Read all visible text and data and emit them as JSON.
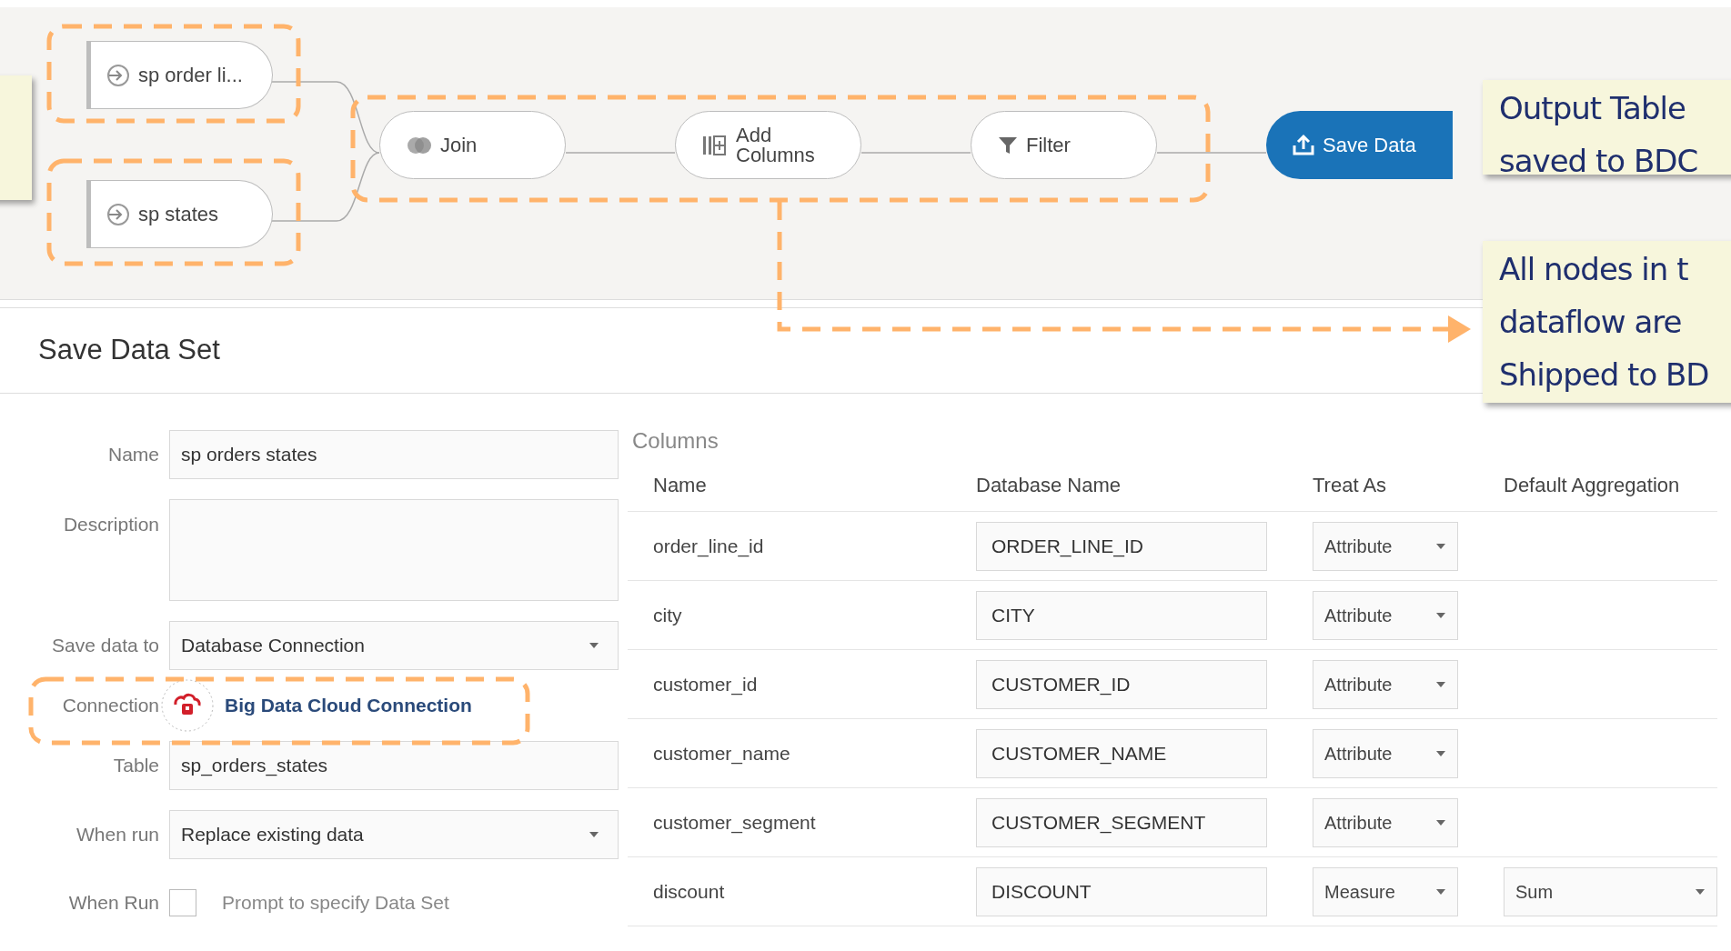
{
  "flow": {
    "nodes": [
      {
        "label": "sp order li...",
        "kind": "source"
      },
      {
        "label": "sp states",
        "kind": "source"
      },
      {
        "label": "Join",
        "kind": "join"
      },
      {
        "label": "Add Columns",
        "kind": "add_columns"
      },
      {
        "label": "Filter",
        "kind": "filter"
      },
      {
        "label": "Save Data",
        "kind": "save"
      }
    ]
  },
  "callouts": [
    {
      "lines": [
        "Output Table",
        "saved to BDC"
      ]
    },
    {
      "lines": [
        "All nodes in t",
        "dataflow are",
        "Shipped to BD"
      ]
    }
  ],
  "panel": {
    "title": "Save Data Set",
    "fields": [
      {
        "kind": "text",
        "label": "Name",
        "value": "sp orders states"
      },
      {
        "kind": "textarea",
        "label": "Description"
      },
      {
        "kind": "select",
        "label": "Save data to",
        "value": "Database Connection"
      },
      {
        "kind": "connection",
        "label": "Connection",
        "value": "Big Data Cloud Connection"
      },
      {
        "kind": "text",
        "label": "Table",
        "value": "sp_orders_states"
      },
      {
        "kind": "select",
        "label": "When run",
        "value": "Replace existing data"
      },
      {
        "kind": "checkbox",
        "label": "When Run",
        "text": "Prompt to specify Data Set",
        "checked": false
      }
    ],
    "columns": {
      "title": "Columns",
      "headers": [
        "Name",
        "Database Name",
        "Treat As",
        "Default Aggregation"
      ],
      "rows": [
        {
          "name": "order_line_id",
          "db_name": "ORDER_LINE_ID",
          "treat_as": "Attribute"
        },
        {
          "name": "city",
          "db_name": "CITY",
          "treat_as": "Attribute"
        },
        {
          "name": "customer_id",
          "db_name": "CUSTOMER_ID",
          "treat_as": "Attribute"
        },
        {
          "name": "customer_name",
          "db_name": "CUSTOMER_NAME",
          "treat_as": "Attribute"
        },
        {
          "name": "customer_segment",
          "db_name": "CUSTOMER_SEGMENT",
          "treat_as": "Attribute"
        },
        {
          "name": "discount",
          "db_name": "DISCOUNT",
          "treat_as": "Measure",
          "aggregation": "Sum"
        }
      ]
    }
  }
}
